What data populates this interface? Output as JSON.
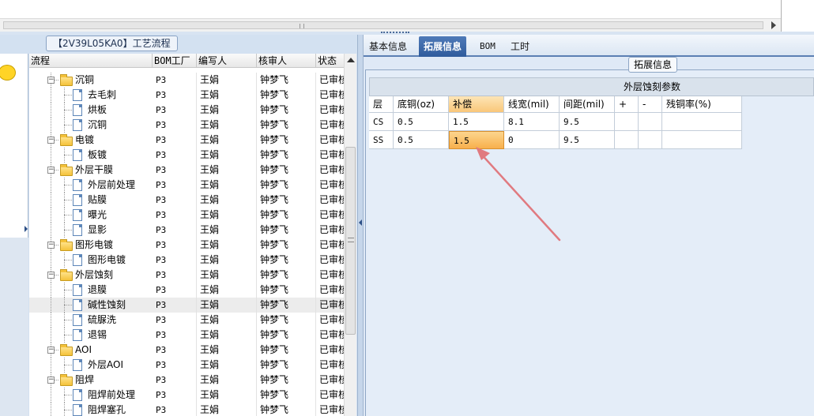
{
  "left_panel": {
    "title": "【2V39L05KA0】工艺流程",
    "columns": [
      "流程",
      "BOM工厂",
      "编写人",
      "核审人",
      "状态"
    ],
    "rows": [
      {
        "level": 1,
        "type": "folder",
        "name": "沉铜",
        "bom": "P3",
        "writer": "王娟",
        "reviewer": "钟梦飞",
        "status": "已审核"
      },
      {
        "level": 2,
        "type": "doc",
        "name": "去毛刺",
        "bom": "P3",
        "writer": "王娟",
        "reviewer": "钟梦飞",
        "status": "已审核"
      },
      {
        "level": 2,
        "type": "doc",
        "name": "烘板",
        "bom": "P3",
        "writer": "王娟",
        "reviewer": "钟梦飞",
        "status": "已审核"
      },
      {
        "level": 2,
        "type": "doc",
        "name": "沉铜",
        "bom": "P3",
        "writer": "王娟",
        "reviewer": "钟梦飞",
        "status": "已审核"
      },
      {
        "level": 1,
        "type": "folder",
        "name": "电镀",
        "bom": "P3",
        "writer": "王娟",
        "reviewer": "钟梦飞",
        "status": "已审核"
      },
      {
        "level": 2,
        "type": "doc",
        "name": "板镀",
        "bom": "P3",
        "writer": "王娟",
        "reviewer": "钟梦飞",
        "status": "已审核"
      },
      {
        "level": 1,
        "type": "folder",
        "name": "外层干膜",
        "bom": "P3",
        "writer": "王娟",
        "reviewer": "钟梦飞",
        "status": "已审核"
      },
      {
        "level": 2,
        "type": "doc",
        "name": "外层前处理",
        "bom": "P3",
        "writer": "王娟",
        "reviewer": "钟梦飞",
        "status": "已审核"
      },
      {
        "level": 2,
        "type": "doc",
        "name": "贴膜",
        "bom": "P3",
        "writer": "王娟",
        "reviewer": "钟梦飞",
        "status": "已审核"
      },
      {
        "level": 2,
        "type": "doc",
        "name": "曝光",
        "bom": "P3",
        "writer": "王娟",
        "reviewer": "钟梦飞",
        "status": "已审核"
      },
      {
        "level": 2,
        "type": "doc",
        "name": "显影",
        "bom": "P3",
        "writer": "王娟",
        "reviewer": "钟梦飞",
        "status": "已审核"
      },
      {
        "level": 1,
        "type": "folder",
        "name": "图形电镀",
        "bom": "P3",
        "writer": "王娟",
        "reviewer": "钟梦飞",
        "status": "已审核"
      },
      {
        "level": 2,
        "type": "doc",
        "name": "图形电镀",
        "bom": "P3",
        "writer": "王娟",
        "reviewer": "钟梦飞",
        "status": "已审核"
      },
      {
        "level": 1,
        "type": "folder",
        "name": "外层蚀刻",
        "bom": "P3",
        "writer": "王娟",
        "reviewer": "钟梦飞",
        "status": "已审核"
      },
      {
        "level": 2,
        "type": "doc",
        "name": "退膜",
        "bom": "P3",
        "writer": "王娟",
        "reviewer": "钟梦飞",
        "status": "已审核"
      },
      {
        "level": 2,
        "type": "doc",
        "name": "碱性蚀刻",
        "bom": "P3",
        "writer": "王娟",
        "reviewer": "钟梦飞",
        "status": "已审核",
        "selected": true
      },
      {
        "level": 2,
        "type": "doc",
        "name": "硫脲洗",
        "bom": "P3",
        "writer": "王娟",
        "reviewer": "钟梦飞",
        "status": "已审核"
      },
      {
        "level": 2,
        "type": "doc",
        "name": "退锡",
        "bom": "P3",
        "writer": "王娟",
        "reviewer": "钟梦飞",
        "status": "已审核"
      },
      {
        "level": 1,
        "type": "folder",
        "name": "AOI",
        "bom": "P3",
        "writer": "王娟",
        "reviewer": "钟梦飞",
        "status": "已审核"
      },
      {
        "level": 2,
        "type": "doc",
        "name": "外层AOI",
        "bom": "P3",
        "writer": "王娟",
        "reviewer": "钟梦飞",
        "status": "已审核"
      },
      {
        "level": 1,
        "type": "folder",
        "name": "阻焊",
        "bom": "P3",
        "writer": "王娟",
        "reviewer": "钟梦飞",
        "status": "已审核"
      },
      {
        "level": 2,
        "type": "doc",
        "name": "阻焊前处理",
        "bom": "P3",
        "writer": "王娟",
        "reviewer": "钟梦飞",
        "status": "已审核"
      },
      {
        "level": 2,
        "type": "doc",
        "name": "阻焊塞孔",
        "bom": "P3",
        "writer": "王娟",
        "reviewer": "钟梦飞",
        "status": "已审核"
      }
    ]
  },
  "right_panel": {
    "tabs": [
      "基本信息",
      "拓展信息",
      "BOM",
      "工时"
    ],
    "active_tab": "拓展信息",
    "group_title": "拓展信息",
    "table_caption": "外层蚀刻参数",
    "columns": [
      "层",
      "底铜(oz)",
      "补偿",
      "线宽(mil)",
      "间距(mil)",
      "+",
      "-",
      "残铜率(%)"
    ],
    "rows": [
      [
        "CS",
        "0.5",
        "1.5",
        "8.1",
        "9.5",
        "",
        "",
        ""
      ],
      [
        "SS",
        "0.5",
        "1.5",
        "0",
        "9.5",
        "",
        "",
        ""
      ]
    ]
  },
  "colors": {
    "active_tab": "#3a66a8",
    "highlight_cell": "#f8b04c",
    "annotation_arrow": "#e07a80"
  }
}
